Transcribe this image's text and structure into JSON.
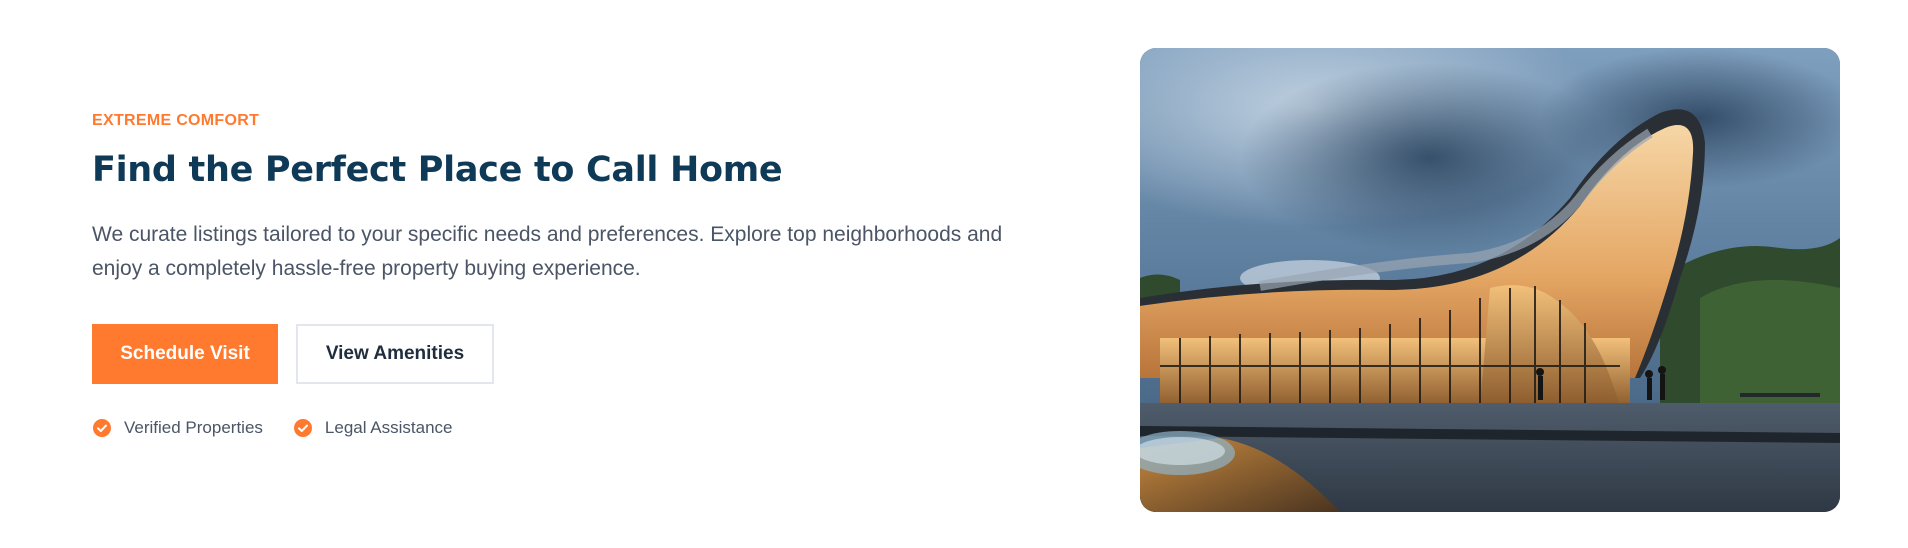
{
  "hero": {
    "eyebrow": "EXTREME COMFORT",
    "title": "Find the Perfect Place to Call Home",
    "description_line1": "We curate listings tailored to your specific needs and preferences. Explore top neighborhoods and",
    "description_line2": "enjoy a completely hassle-free property buying experience.",
    "primary_button": "Schedule Visit",
    "secondary_button": "View Amenities",
    "badges": [
      {
        "label": "Verified Properties",
        "icon": "check-circle-icon"
      },
      {
        "label": "Legal Assistance",
        "icon": "check-circle-icon"
      }
    ]
  },
  "colors": {
    "accent": "#ff7a2f",
    "heading": "#0f3a57",
    "body_text": "#4b5566",
    "button_border": "#e3e6ee"
  },
  "image": {
    "subject": "modern-curved-architecture-building-photo"
  }
}
